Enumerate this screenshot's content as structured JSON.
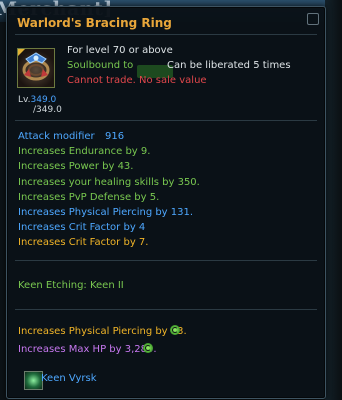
{
  "background": {
    "title_fragment": "Merchant]"
  },
  "tooltip": {
    "title": "Warlord's Bracing Ring",
    "requirement": "For level 70 or above",
    "soulbound_label": "Soulbound to",
    "liberation": "Can be liberated 5 times",
    "trade": "Cannot trade. No sale value",
    "level_label": "Lv.",
    "level_value": "349.0",
    "level_max": "/349.0"
  },
  "stats": {
    "attack_label": "Attack modifier",
    "attack_value": "916",
    "lines": [
      "Increases Endurance by 9.",
      "Increases Power by 43.",
      "Increases your healing skills by 350.",
      "Increases PvP Defense by 5.",
      "Increases Physical Piercing by 131.",
      "Increases Crit Factor by 4",
      "Increases Crit Factor by 7."
    ]
  },
  "etching": "Keen Etching: Keen II",
  "bonus": {
    "line1": "Increases Physical Piercing by 33.",
    "line2": "Increases Max HP by 3,280."
  },
  "crystal": {
    "name": "Keen Vyrsk"
  },
  "colors": {
    "title": "#e8a63a",
    "green": "#79c850",
    "blue": "#4ea8ff",
    "gold": "#f0b428",
    "red": "#e0474b",
    "purple": "#c778f0"
  },
  "icons": [
    "ring-icon",
    "refresh-icon",
    "crystal-icon",
    "close-icon"
  ]
}
